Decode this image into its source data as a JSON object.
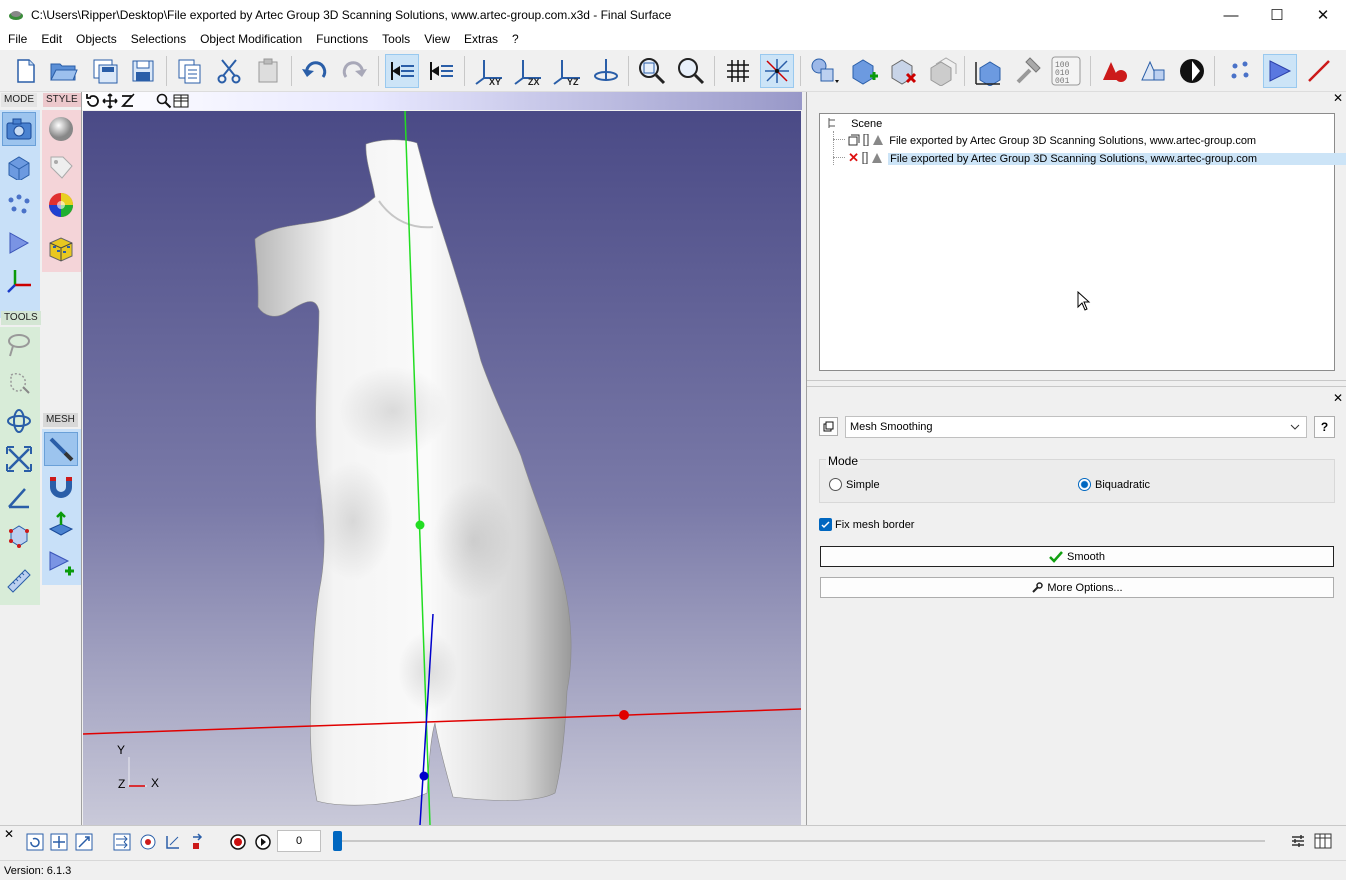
{
  "window": {
    "title": "C:\\Users\\Ripper\\Desktop\\File exported by Artec Group 3D Scanning Solutions, www.artec-group.com.x3d - Final Surface"
  },
  "menu": [
    "File",
    "Edit",
    "Objects",
    "Selections",
    "Object Modification",
    "Functions",
    "Tools",
    "View",
    "Extras",
    "?"
  ],
  "left_panel": {
    "mode_label": "MODE",
    "style_label": "STYLE",
    "tools_label": "TOOLS",
    "mesh_label": "MESH"
  },
  "viewport": {
    "axis_y": "Y",
    "axis_z": "Z",
    "axis_x": "X"
  },
  "scene": {
    "root": "Scene",
    "items": [
      {
        "label": "File exported by Artec Group 3D Scanning Solutions, www.artec-group.com",
        "selected": false
      },
      {
        "label": "File exported by Artec Group 3D Scanning Solutions, www.artec-group.com",
        "selected": true
      }
    ]
  },
  "tool_panel": {
    "function": "Mesh Smoothing",
    "help": "?",
    "mode_label": "Mode",
    "mode_options": [
      "Simple",
      "Biquadratic"
    ],
    "mode_selected": "Biquadratic",
    "fix_border_label": "Fix mesh border",
    "fix_border_checked": true,
    "smooth_button": "Smooth",
    "more_options_button": "More Options..."
  },
  "animation": {
    "frame": "0"
  },
  "status": {
    "version": "Version: 6.1.3"
  },
  "colors": {
    "selection": "#cce4f7",
    "x_axis": "#e00000",
    "y_axis": "#22dd22",
    "z_axis": "#0000cc"
  }
}
